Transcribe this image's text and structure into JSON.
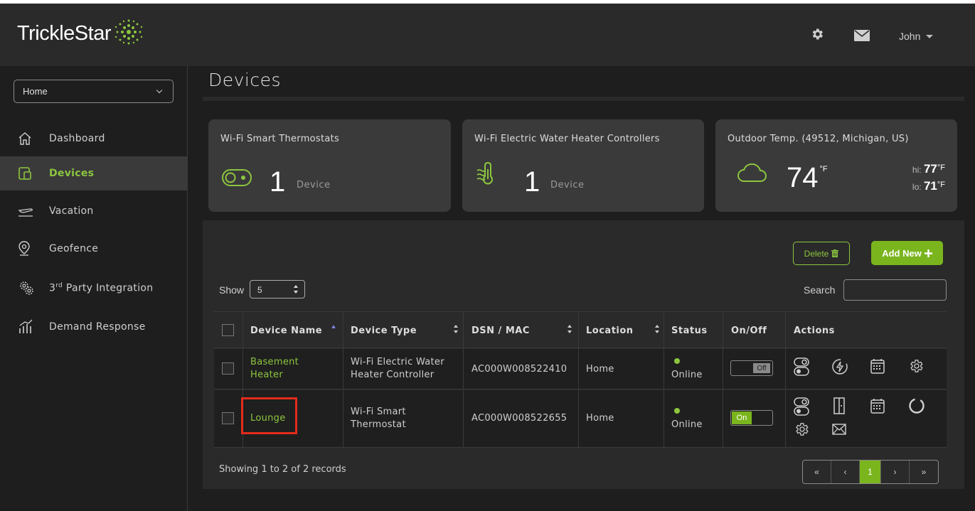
{
  "brand": {
    "name": "TrickleStar",
    "accent": "#8cc63f",
    "button_green": "#7ab51d"
  },
  "header": {
    "settings_icon": "gear-icon",
    "mail_icon": "envelope-icon",
    "user_name": "John"
  },
  "sidebar": {
    "home_select": "Home",
    "items": [
      {
        "label": "Dashboard",
        "icon": "home-icon",
        "active": false
      },
      {
        "label": "Devices",
        "icon": "device-icon",
        "active": true
      },
      {
        "label": "Vacation",
        "icon": "plane-icon",
        "active": false
      },
      {
        "label_main": "3",
        "label_sup": "rd",
        "label_rest": " Party Integration",
        "icon": "gears-icon",
        "active": false
      },
      {
        "label": "Geofence",
        "icon": "location-icon",
        "active": false
      },
      {
        "label": "Demand Response",
        "icon": "chart-icon",
        "active": false
      }
    ]
  },
  "page": {
    "title": "Devices"
  },
  "cards": {
    "thermostats": {
      "title": "Wi-Fi Smart Thermostats",
      "count": "1",
      "unit": "Device"
    },
    "water_heaters": {
      "title": "Wi-Fi Electric Water Heater Controllers",
      "count": "1",
      "unit": "Device"
    },
    "outdoor": {
      "title": "Outdoor Temp. (49512, Michigan, US)",
      "temp": "74",
      "temp_unit": "°F",
      "hi_label": "hi:",
      "hi_value": "77",
      "lo_label": "lo:",
      "lo_value": "71",
      "unit": "°F"
    }
  },
  "toolbar": {
    "delete_label": "Delete",
    "add_label": "Add New",
    "show_label": "Show",
    "show_value": "5",
    "search_label": "Search",
    "search_value": ""
  },
  "table": {
    "columns": [
      "Device Name",
      "Device Type",
      "DSN / MAC",
      "Location",
      "Status",
      "On/Off",
      "Actions"
    ],
    "rows": [
      {
        "name_line1": "Basement",
        "name_line2": "Heater",
        "type_line1": "Wi-Fi Electric Water",
        "type_line2": "Heater Controller",
        "dsn": "AC000W008522410",
        "location": "Home",
        "status": "Online",
        "switch": "Off"
      },
      {
        "name_line1": "Lounge",
        "name_line2": "",
        "type_line1": "Wi-Fi Smart",
        "type_line2": "Thermostat",
        "dsn": "AC000W008522655",
        "location": "Home",
        "status": "Online",
        "switch": "On"
      }
    ]
  },
  "footer": {
    "showing": "Showing 1 to 2 of 2 records",
    "pager": [
      "«",
      "‹",
      "1",
      "›",
      "»"
    ]
  }
}
